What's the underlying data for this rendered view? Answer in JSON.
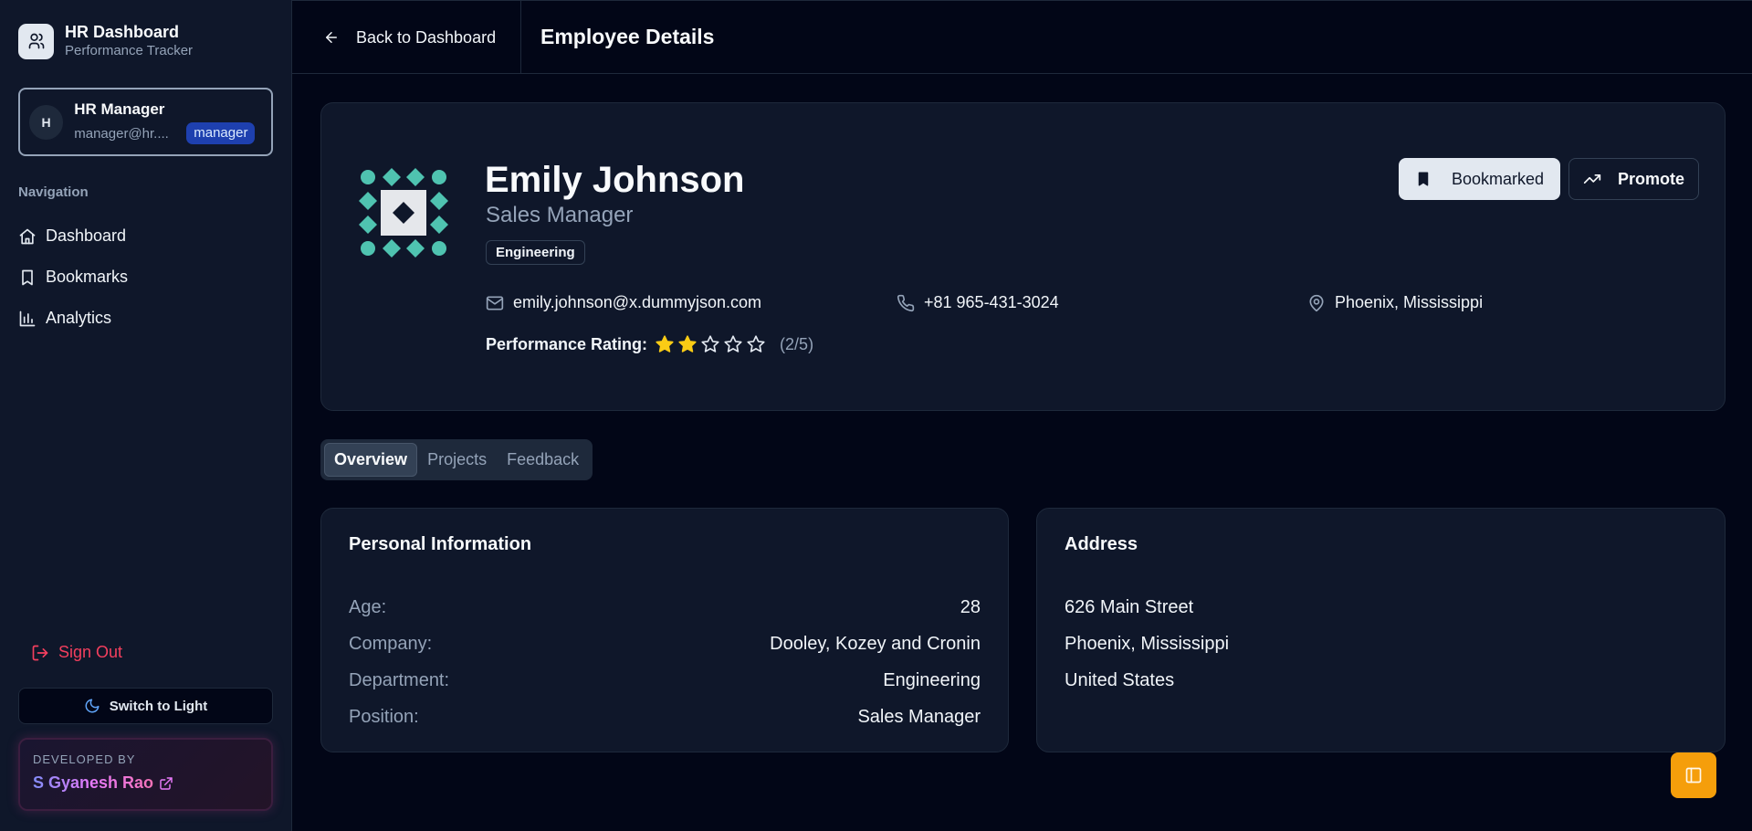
{
  "brand": {
    "title": "HR Dashboard",
    "subtitle": "Performance Tracker",
    "icon": "users-icon"
  },
  "user": {
    "initial": "H",
    "name": "HR Manager",
    "email": "manager@hr....",
    "role": "manager"
  },
  "nav": {
    "heading": "Navigation",
    "items": [
      {
        "label": "Dashboard",
        "icon": "home-icon"
      },
      {
        "label": "Bookmarks",
        "icon": "bookmark-icon"
      },
      {
        "label": "Analytics",
        "icon": "bar-chart-icon"
      }
    ]
  },
  "sidebar_footer": {
    "sign_out": "Sign Out",
    "theme_toggle": "Switch to Light",
    "developed_by": "DEVELOPED BY",
    "developer": "S Gyanesh Rao"
  },
  "topbar": {
    "back_label": "Back to Dashboard",
    "title": "Employee Details"
  },
  "employee": {
    "name": "Emily Johnson",
    "title": "Sales Manager",
    "department_badge": "Engineering",
    "email": "emily.johnson@x.dummyjson.com",
    "phone": "+81 965-431-3024",
    "location": "Phoenix, Mississippi",
    "rating_label": "Performance Rating:",
    "rating": 2,
    "rating_max": 5,
    "rating_text": "(2/5)"
  },
  "actions": {
    "bookmark": "Bookmarked",
    "promote": "Promote"
  },
  "tabs": [
    {
      "label": "Overview",
      "active": true
    },
    {
      "label": "Projects",
      "active": false
    },
    {
      "label": "Feedback",
      "active": false
    }
  ],
  "personal_info": {
    "heading": "Personal Information",
    "rows": [
      {
        "key": "Age:",
        "value": "28"
      },
      {
        "key": "Company:",
        "value": "Dooley, Kozey and Cronin"
      },
      {
        "key": "Department:",
        "value": "Engineering"
      },
      {
        "key": "Position:",
        "value": "Sales Manager"
      }
    ]
  },
  "address": {
    "heading": "Address",
    "lines": [
      "626 Main Street",
      "Phoenix, Mississippi",
      "United States"
    ]
  },
  "colors": {
    "accent": "#f59e0b",
    "star": "#facc15",
    "danger": "#f43f5e",
    "role_badge": "#1e40af"
  }
}
